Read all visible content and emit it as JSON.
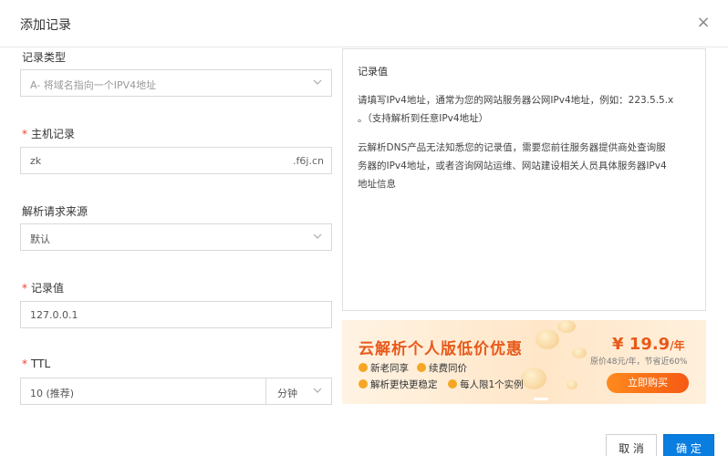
{
  "dialog": {
    "title": "添加记录",
    "close_symbol": "×"
  },
  "form": {
    "record_type": {
      "label": "记录类型",
      "value": "A- 将域名指向一个IPV4地址"
    },
    "host": {
      "required_mark": "*",
      "label": "主机记录",
      "value": "zk",
      "suffix": ".f6j.cn"
    },
    "source": {
      "label": "解析请求来源",
      "value": "默认"
    },
    "record_value": {
      "required_mark": "*",
      "label": "记录值",
      "value": "127.0.0.1"
    },
    "ttl": {
      "required_mark": "*",
      "label": "TTL",
      "value": "10 (推荐)",
      "unit": "分钟"
    }
  },
  "help": {
    "title": "记录值",
    "para1_line1": "请填写IPv4地址，通常为您的网站服务器公网IPv4地址，例如：223.5.5.x",
    "para1_line2": "。（支持解析到任意IPv4地址）",
    "para2_line1": "云解析DNS产品无法知悉您的记录值，需要您前往服务器提供商处查询服",
    "para2_line2": "务器的IPv4地址，或者咨询网站运维、网站建设相关人员具体服务器IPv4",
    "para2_line3": "地址信息"
  },
  "ad": {
    "headline": "云解析个人版低价优惠",
    "features": [
      "新老同享",
      "续费同价",
      "解析更快更稳定",
      "每人限1个实例"
    ],
    "price": "¥ 19.9",
    "price_unit": "/年",
    "original": "原价48元/年，节省近60%",
    "cta": "立即购买"
  },
  "footer": {
    "cancel_label": "取 消",
    "ok_label": "确 定"
  }
}
